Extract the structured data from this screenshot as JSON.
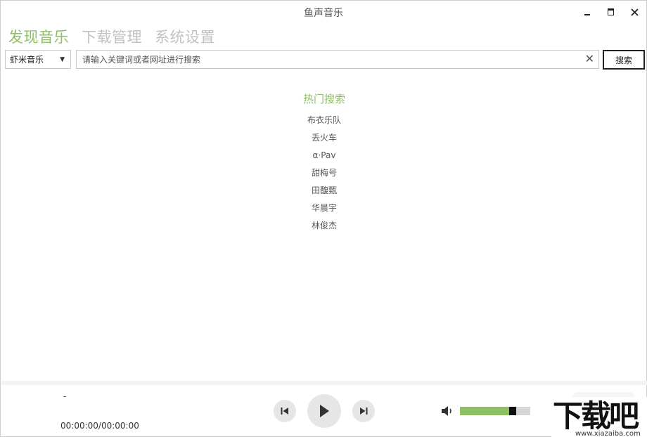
{
  "window": {
    "title": "鱼声音乐"
  },
  "nav": {
    "tabs": [
      {
        "label": "发现音乐",
        "active": true
      },
      {
        "label": "下载管理",
        "active": false
      },
      {
        "label": "系统设置",
        "active": false
      }
    ]
  },
  "search": {
    "source_selected": "虾米音乐",
    "placeholder": "请输入关键词或者网址进行搜索",
    "value": "",
    "button_label": "搜索"
  },
  "hot_search": {
    "title": "热门搜索",
    "items": [
      "布衣乐队",
      "丢火车",
      "α·Pav",
      "甜梅号",
      "田馥甄",
      "华晨宇",
      "林俊杰"
    ]
  },
  "player": {
    "track_title": "-",
    "time": "00:00:00/00:00:00",
    "volume_fraction": 0.8
  },
  "watermark": {
    "main": "下载吧",
    "url": "www.xiazaiba.com"
  },
  "colors": {
    "accent": "#8cc063",
    "inactive_tab": "#c2c2c2"
  },
  "icons": [
    "minimize-icon",
    "maximize-icon",
    "close-icon",
    "dropdown-caret-icon",
    "clear-icon",
    "previous-icon",
    "play-icon",
    "next-icon",
    "volume-icon"
  ]
}
